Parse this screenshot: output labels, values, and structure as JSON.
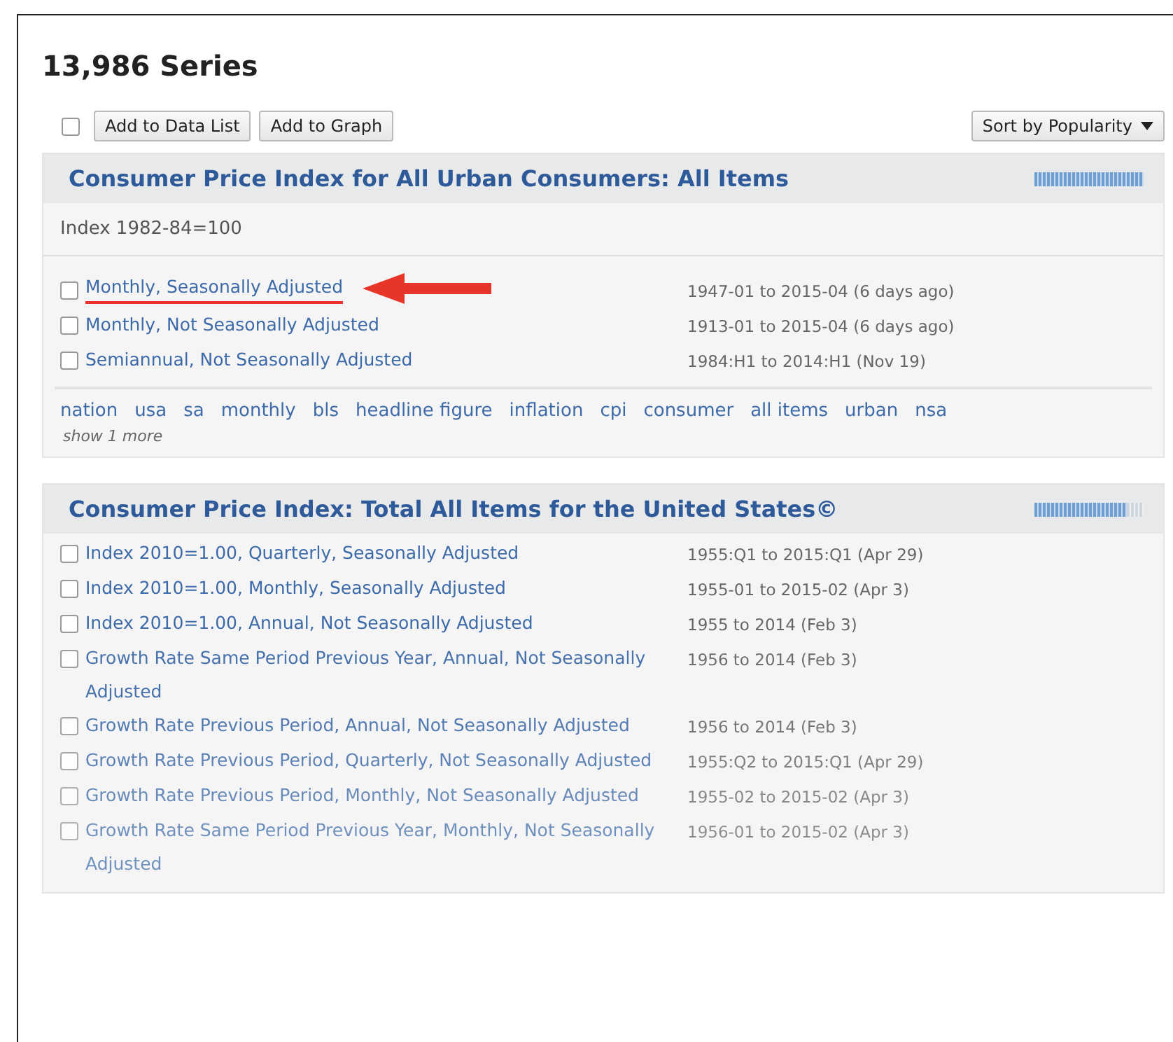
{
  "title": "13,986 Series",
  "toolbar": {
    "select_all_checked": false,
    "buttons": [
      "Add to Data List",
      "Add to Graph"
    ],
    "sort": "Sort by Popularity"
  },
  "groups": [
    {
      "title": "Consumer Price Index for All Urban Consumers: All Items",
      "popularity": {
        "level": 1.0
      },
      "units": "Index 1982-84=100",
      "rows": [
        {
          "label": "Monthly, Seasonally Adjusted",
          "dates": "1947-01 to 2015-04 (6 days ago)",
          "checked": false,
          "annotated": true
        },
        {
          "label": "Monthly, Not Seasonally Adjusted",
          "dates": "1913-01 to 2015-04 (6 days ago)",
          "checked": false,
          "annotated": false
        },
        {
          "label": "Semiannual, Not Seasonally Adjusted",
          "dates": "1984:H1 to 2014:H1 (Nov 19)",
          "checked": false,
          "annotated": false
        }
      ],
      "tags": [
        "nation",
        "usa",
        "sa",
        "monthly",
        "bls",
        "headline figure",
        "inflation",
        "cpi",
        "consumer",
        "all items",
        "urban",
        "nsa"
      ],
      "more": "show 1 more"
    },
    {
      "title": "Consumer Price Index: Total All Items for the United States©",
      "popularity": {
        "level": 0.85
      },
      "rows": [
        {
          "label": "Index 2010=1.00, Quarterly, Seasonally Adjusted",
          "dates": "1955:Q1 to 2015:Q1 (Apr 29)",
          "checked": false,
          "annotated": false
        },
        {
          "label": "Index 2010=1.00, Monthly, Seasonally Adjusted",
          "dates": "1955-01 to 2015-02 (Apr 3)",
          "checked": false,
          "annotated": false
        },
        {
          "label": "Index 2010=1.00, Annual, Not Seasonally Adjusted",
          "dates": "1955 to 2014 (Feb 3)",
          "checked": false,
          "annotated": false
        },
        {
          "label": "Growth Rate Same Period Previous Year, Annual, Not Seasonally Adjusted",
          "dates": "1956 to 2014 (Feb 3)",
          "checked": false,
          "annotated": false
        },
        {
          "label": "Growth Rate Previous Period, Annual, Not Seasonally Adjusted",
          "dates": "1956 to 2014 (Feb 3)",
          "checked": false,
          "annotated": false
        },
        {
          "label": "Growth Rate Previous Period, Quarterly, Not Seasonally Adjusted",
          "dates": "1955:Q2 to 2015:Q1 (Apr 29)",
          "checked": false,
          "annotated": false
        },
        {
          "label": "Growth Rate Previous Period, Monthly, Not Seasonally Adjusted",
          "dates": "1955-02 to 2015-02 (Apr 3)",
          "checked": false,
          "annotated": false
        },
        {
          "label": "Growth Rate Same Period Previous Year, Monthly, Not Seasonally Adjusted",
          "dates": "1956-01 to 2015-02 (Apr 3)",
          "checked": false,
          "annotated": false
        }
      ]
    }
  ]
}
